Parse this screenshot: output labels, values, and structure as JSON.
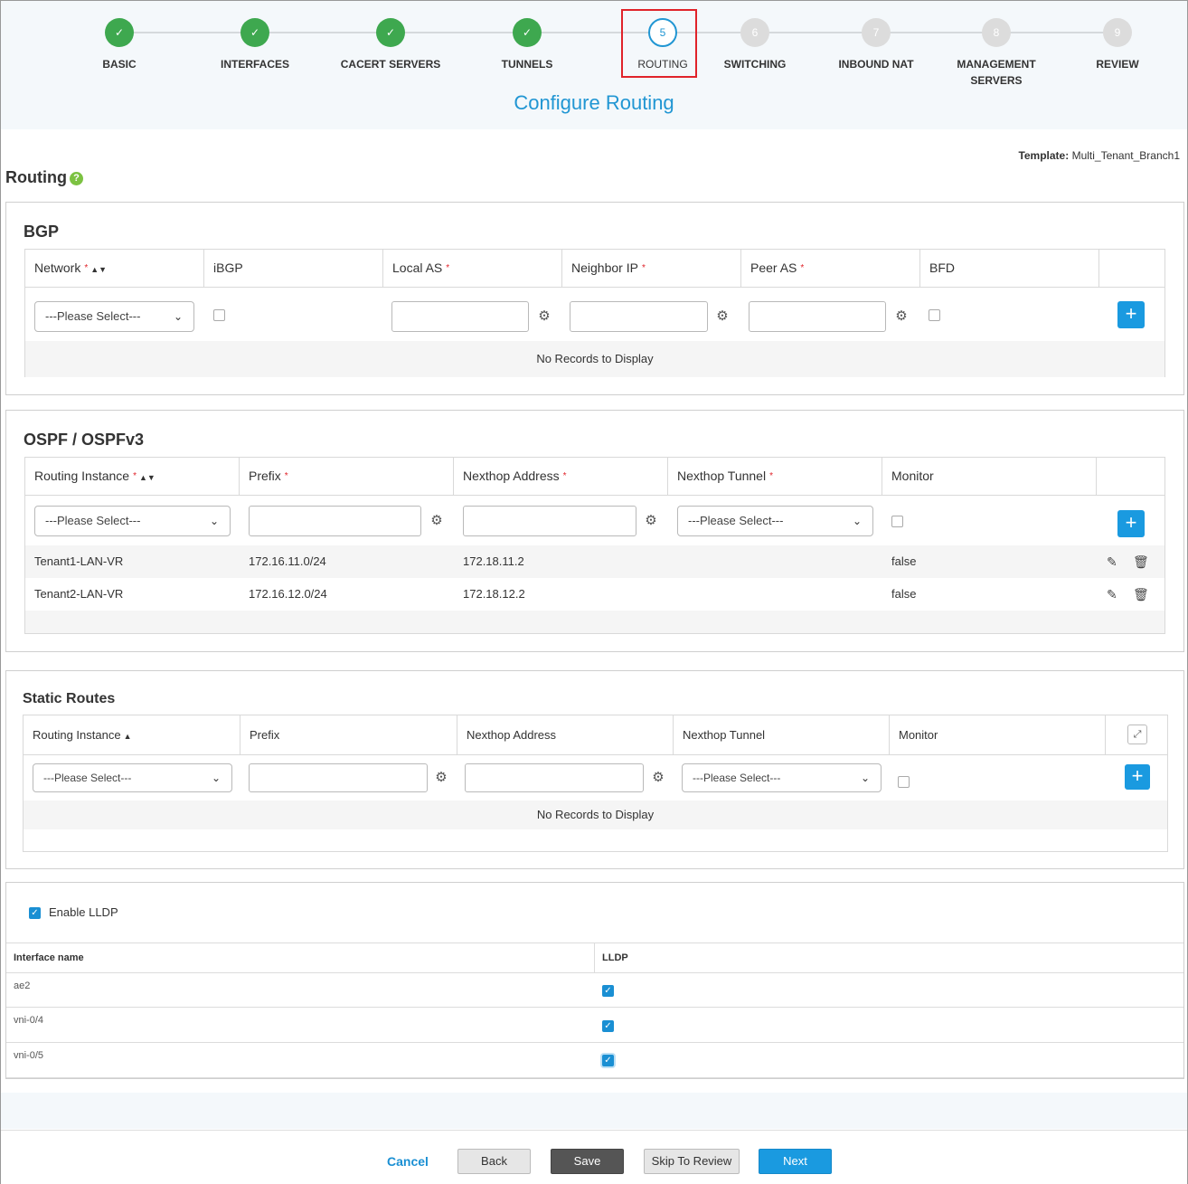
{
  "wizard": {
    "title": "Configure Routing",
    "steps": [
      {
        "num": "1",
        "label": "BASIC",
        "state": "done"
      },
      {
        "num": "2",
        "label": "INTERFACES",
        "state": "done"
      },
      {
        "num": "3",
        "label": "CACERT SERVERS",
        "state": "done"
      },
      {
        "num": "4",
        "label": "TUNNELS",
        "state": "done"
      },
      {
        "num": "5",
        "label": "ROUTING",
        "state": "current"
      },
      {
        "num": "6",
        "label": "SWITCHING",
        "state": "todo"
      },
      {
        "num": "7",
        "label": "INBOUND NAT",
        "state": "todo"
      },
      {
        "num": "8",
        "label": "MANAGEMENT SERVERS",
        "state": "todo"
      },
      {
        "num": "9",
        "label": "REVIEW",
        "state": "todo"
      }
    ]
  },
  "template": {
    "label": "Template:",
    "value": "Multi_Tenant_Branch1"
  },
  "routing": {
    "title": "Routing",
    "help": "?"
  },
  "bgp": {
    "title": "BGP",
    "columns": [
      "Network",
      "iBGP",
      "Local AS",
      "Neighbor IP",
      "Peer AS",
      "BFD"
    ],
    "select_placeholder": "---Please Select---",
    "empty": "No Records to Display"
  },
  "ospf": {
    "title": "OSPF / OSPFv3",
    "columns": [
      "Routing Instance",
      "Prefix",
      "Nexthop Address",
      "Nexthop Tunnel",
      "Monitor"
    ],
    "select_placeholder": "---Please Select---",
    "tunnel_placeholder": "---Please Select---",
    "rows": [
      {
        "instance": "Tenant1-LAN-VR",
        "prefix": "172.16.11.0/24",
        "nexthop": "172.18.11.2",
        "tunnel": "",
        "monitor": "false"
      },
      {
        "instance": "Tenant2-LAN-VR",
        "prefix": "172.16.12.0/24",
        "nexthop": "172.18.12.2",
        "tunnel": "",
        "monitor": "false"
      }
    ]
  },
  "static": {
    "title": "Static Routes",
    "columns": [
      "Routing Instance",
      "Prefix",
      "Nexthop Address",
      "Nexthop Tunnel",
      "Monitor"
    ],
    "select_placeholder": "---Please Select---",
    "tunnel_placeholder": "---Please Select---",
    "empty": "No Records to Display"
  },
  "lldp": {
    "enable_label": "Enable LLDP",
    "enabled": true,
    "columns": [
      "Interface name",
      "LLDP"
    ],
    "rows": [
      {
        "name": "ae2",
        "lldp": true
      },
      {
        "name": "vni-0/4",
        "lldp": true
      },
      {
        "name": "vni-0/5",
        "lldp": true
      }
    ]
  },
  "footer": {
    "cancel": "Cancel",
    "back": "Back",
    "save": "Save",
    "skip": "Skip To Review",
    "next": "Next"
  },
  "colors": {
    "accent": "#1a9ae0",
    "done": "#3ea84f",
    "highlight": "#e0232a"
  }
}
